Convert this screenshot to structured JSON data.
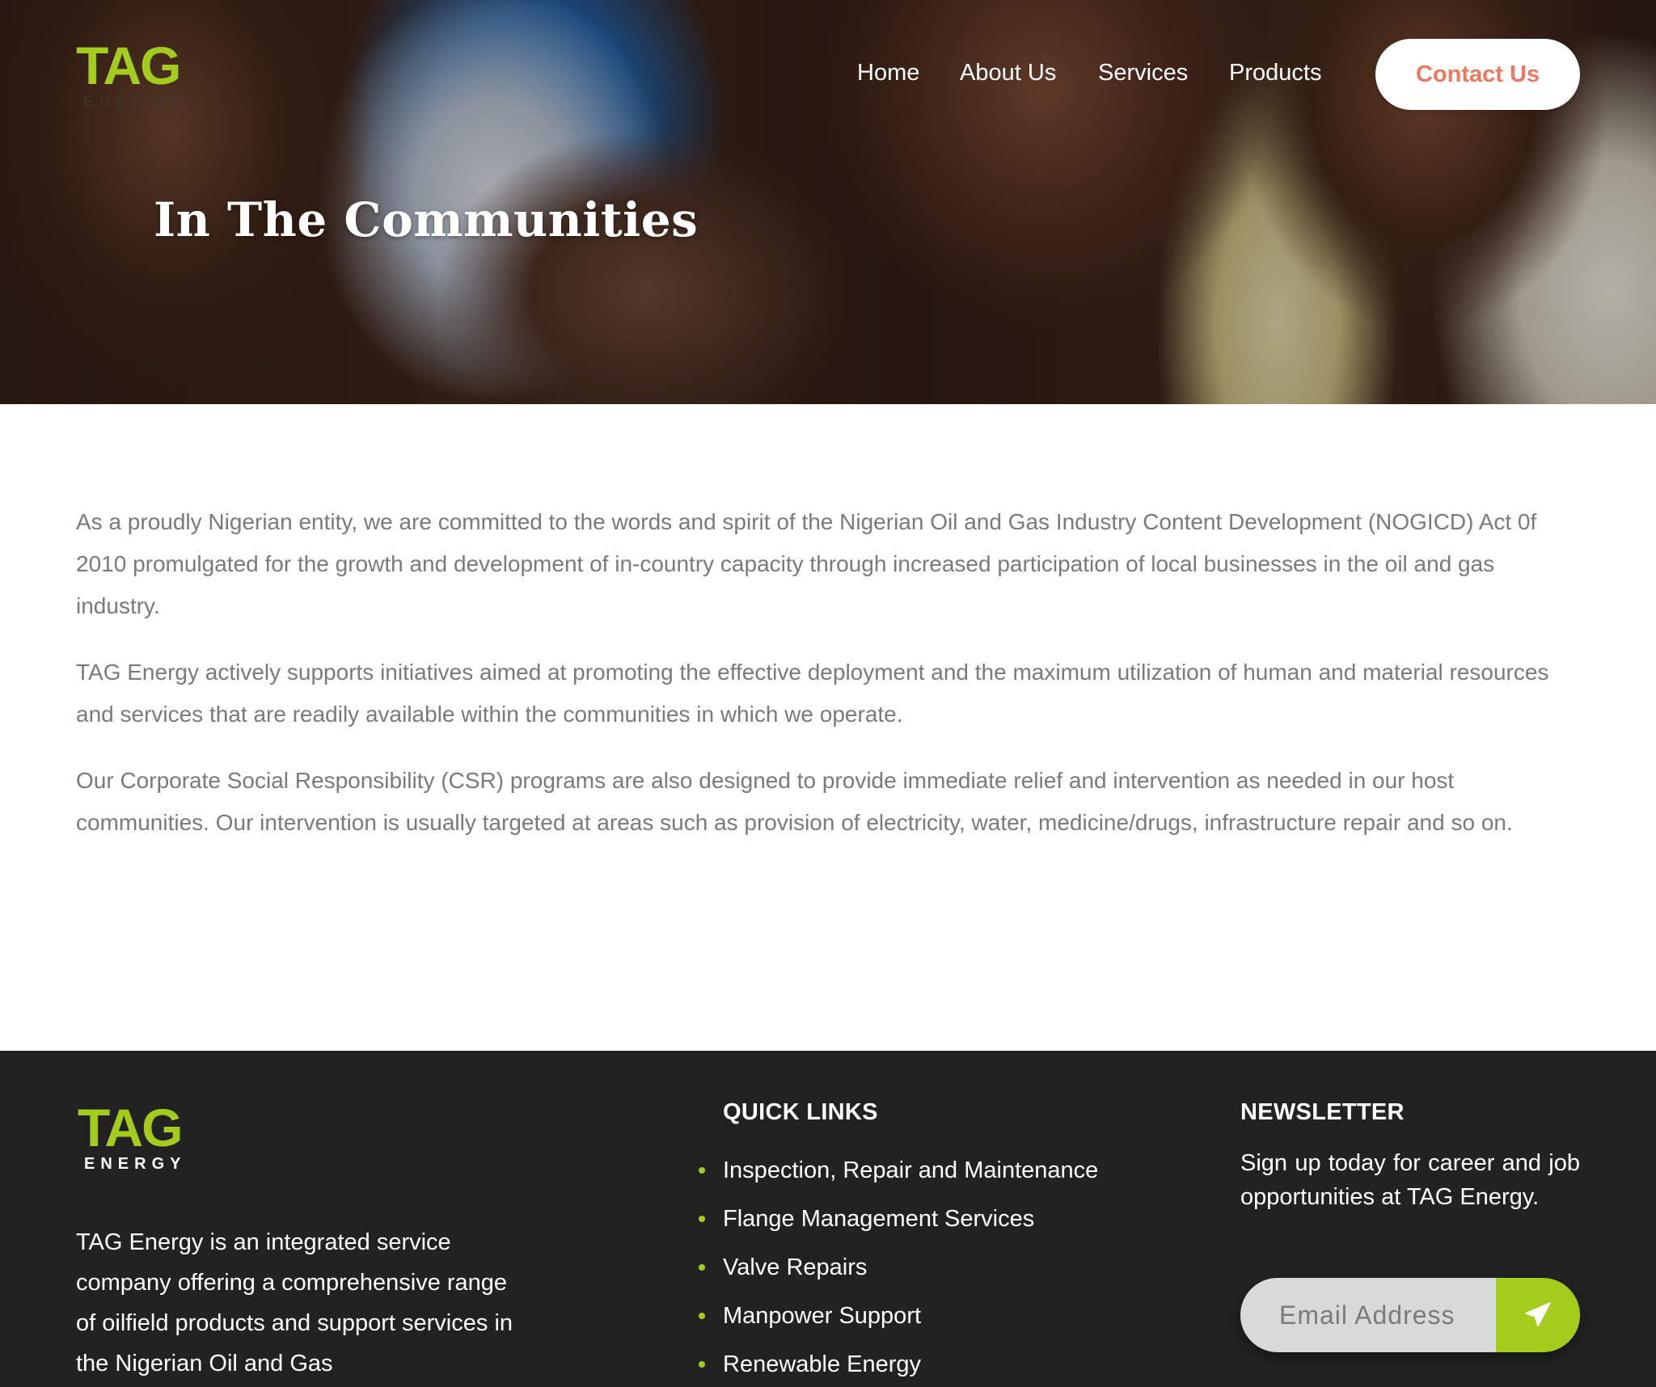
{
  "brand": {
    "logo_text": "TAG",
    "logo_subtext": "ENERGY",
    "logo_color": "#a4cc1c",
    "accent_color": "#ee7760"
  },
  "nav": {
    "items": [
      {
        "label": "Home"
      },
      {
        "label": "About Us"
      },
      {
        "label": "Services"
      },
      {
        "label": "Products"
      }
    ],
    "contact_label": "Contact Us"
  },
  "hero": {
    "title": "In The Communities"
  },
  "content": {
    "paragraphs": [
      "As a proudly Nigerian entity, we are committed to the words and spirit of the Nigerian Oil and Gas Industry Content Development (NOGICD) Act 0f 2010 promulgated for the growth and development of in-country capacity through increased participation of local businesses in the oil and gas industry.",
      "TAG Energy actively supports initiatives aimed at promoting the effective deployment and the maximum utilization of human and material resources and services that are readily available within the communities in which we operate.",
      "Our Corporate Social Responsibility (CSR) programs are also designed to provide immediate relief and intervention as needed in our host communities. Our intervention is usually targeted at areas such as provision of electricity, water, medicine/drugs, infrastructure repair and so on."
    ]
  },
  "footer": {
    "about_text": "TAG Energy is an integrated service company offering a comprehensive range of oilfield products and support services in the Nigerian Oil and Gas",
    "quick_links_heading": "QUICK LINKS",
    "quick_links": [
      "Inspection, Repair and Maintenance",
      "Flange Management Services",
      "Valve Repairs",
      "Manpower Support",
      "Renewable Energy"
    ],
    "newsletter_heading": "NEWSLETTER",
    "newsletter_text": "Sign up today for career and job opportunities at TAG Energy.",
    "email_placeholder": "Email Address",
    "send_icon": "paper-plane-icon"
  }
}
